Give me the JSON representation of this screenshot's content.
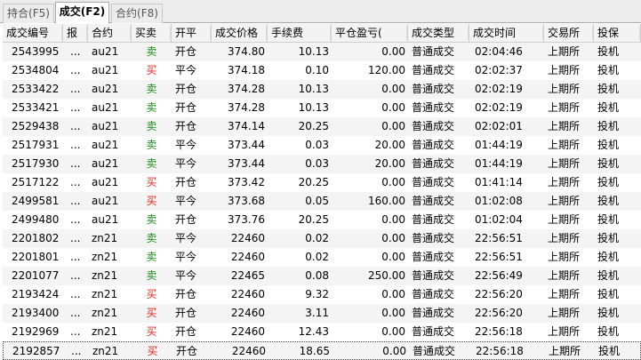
{
  "tabs": [
    {
      "label": "持合(F5)",
      "active": false
    },
    {
      "label": "成交(F2)",
      "active": true
    },
    {
      "label": "合约(F8)",
      "active": false
    }
  ],
  "columns": [
    "成交编号",
    "报",
    "合约",
    "买卖",
    "开平",
    "成交价格",
    "手续费",
    "平仓盈亏(",
    "成交类型",
    "成交时间",
    "交易所",
    "投保"
  ],
  "colors": {
    "buy": "#e0261b",
    "sell": "#1a8e1a"
  },
  "rows": [
    [
      "2543995",
      "...",
      "au21",
      "卖",
      "开仓",
      "374.80",
      "10.13",
      "0.00",
      "普通成交",
      "02:04:46",
      "上期所",
      "投机"
    ],
    [
      "2534804",
      "...",
      "au21",
      "买",
      "平今",
      "374.18",
      "0.10",
      "120.00",
      "普通成交",
      "02:02:37",
      "上期所",
      "投机"
    ],
    [
      "2533422",
      "...",
      "au21",
      "卖",
      "开仓",
      "374.28",
      "10.13",
      "0.00",
      "普通成交",
      "02:02:19",
      "上期所",
      "投机"
    ],
    [
      "2533421",
      "...",
      "au21",
      "卖",
      "开仓",
      "374.28",
      "10.13",
      "0.00",
      "普通成交",
      "02:02:19",
      "上期所",
      "投机"
    ],
    [
      "2529438",
      "...",
      "au21",
      "卖",
      "开仓",
      "374.14",
      "20.25",
      "0.00",
      "普通成交",
      "02:02:01",
      "上期所",
      "投机"
    ],
    [
      "2517931",
      "...",
      "au21",
      "卖",
      "平今",
      "373.44",
      "0.03",
      "20.00",
      "普通成交",
      "01:44:19",
      "上期所",
      "投机"
    ],
    [
      "2517930",
      "...",
      "au21",
      "卖",
      "平今",
      "373.44",
      "0.03",
      "20.00",
      "普通成交",
      "01:44:19",
      "上期所",
      "投机"
    ],
    [
      "2517122",
      "...",
      "au21",
      "买",
      "开仓",
      "373.42",
      "20.25",
      "0.00",
      "普通成交",
      "01:41:14",
      "上期所",
      "投机"
    ],
    [
      "2499581",
      "...",
      "au21",
      "买",
      "平今",
      "373.68",
      "0.05",
      "160.00",
      "普通成交",
      "01:02:08",
      "上期所",
      "投机"
    ],
    [
      "2499480",
      "...",
      "au21",
      "卖",
      "开仓",
      "373.76",
      "20.25",
      "0.00",
      "普通成交",
      "01:02:04",
      "上期所",
      "投机"
    ],
    [
      "2201802",
      "...",
      "zn21",
      "卖",
      "平今",
      "22460",
      "0.02",
      "0.00",
      "普通成交",
      "22:56:51",
      "上期所",
      "投机"
    ],
    [
      "2201801",
      "...",
      "zn21",
      "卖",
      "平今",
      "22460",
      "0.02",
      "0.00",
      "普通成交",
      "22:56:51",
      "上期所",
      "投机"
    ],
    [
      "2201077",
      "...",
      "zn21",
      "卖",
      "平今",
      "22465",
      "0.08",
      "250.00",
      "普通成交",
      "22:56:49",
      "上期所",
      "投机"
    ],
    [
      "2193424",
      "...",
      "zn21",
      "买",
      "开仓",
      "22460",
      "9.32",
      "0.00",
      "普通成交",
      "22:56:20",
      "上期所",
      "投机"
    ],
    [
      "2193400",
      "...",
      "zn21",
      "买",
      "开仓",
      "22460",
      "3.11",
      "0.00",
      "普通成交",
      "22:56:20",
      "上期所",
      "投机"
    ],
    [
      "2192969",
      "...",
      "zn21",
      "买",
      "开仓",
      "22460",
      "12.43",
      "0.00",
      "普通成交",
      "22:56:18",
      "上期所",
      "投机"
    ],
    [
      "2192857",
      "...",
      "zn21",
      "买",
      "开仓",
      "22460",
      "18.65",
      "0.00",
      "普通成交",
      "22:56:18",
      "上期所",
      "投机"
    ]
  ]
}
